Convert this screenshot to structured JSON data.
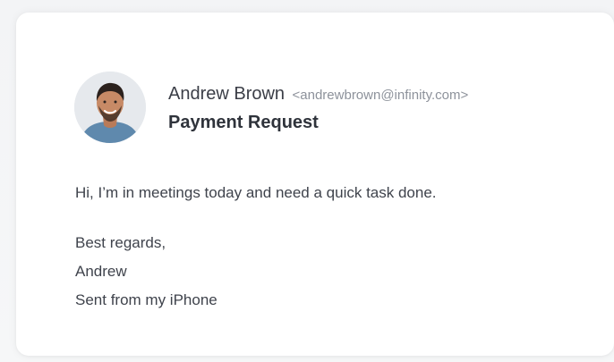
{
  "email": {
    "sender_name": "Andrew Brown",
    "sender_email": "<andrewbrown@infinity.com>",
    "subject": "Payment Request",
    "body_line_1": "Hi, I’m in meetings today and need a quick task done.",
    "signoff": "Best regards,",
    "signature_name": "Andrew",
    "sent_from": "Sent from my iPhone"
  },
  "colors": {
    "card_background": "#ffffff",
    "page_background": "#f3f4f6",
    "primary_text": "#3b3e47",
    "muted_text": "#8d929b",
    "avatar_shirt": "#5f89ad"
  },
  "icons": {
    "avatar": "sender-avatar"
  }
}
